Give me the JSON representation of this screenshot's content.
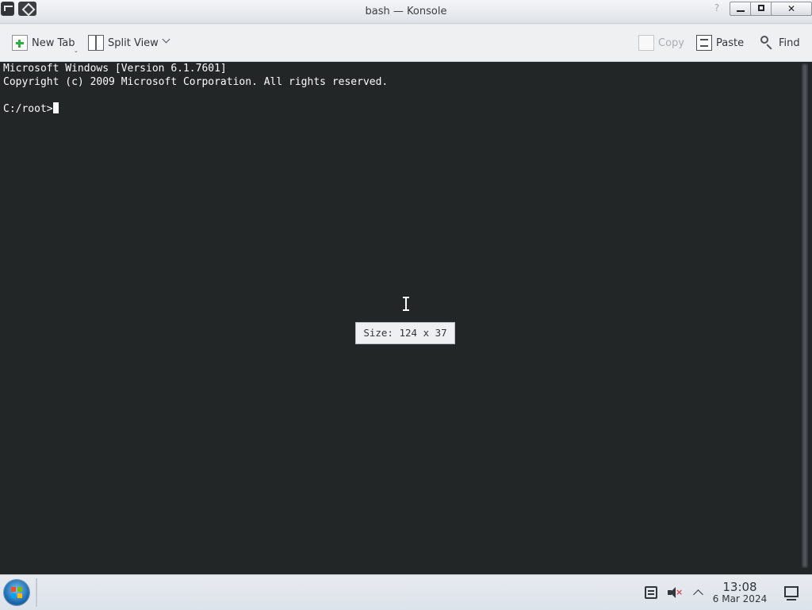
{
  "window": {
    "title": "bash — Konsole"
  },
  "toolbar": {
    "new_tab": "New Tab",
    "split_view": "Split View",
    "copy": "Copy",
    "paste": "Paste",
    "find": "Find"
  },
  "terminal": {
    "lines": [
      "Microsoft Windows [Version 6.1.7601]",
      "Copyright (c) 2009 Microsoft Corporation. All rights reserved.",
      "",
      "C:/root>"
    ],
    "size_popup": "Size: 124 x 37"
  },
  "taskbar": {
    "time": "13:08",
    "date": "6 Mar 2024"
  },
  "colors": {
    "terminal_bg": "#232627",
    "terminal_fg": "#fcfcfc",
    "toolbar_bg": "#eff0f1",
    "accent_green": "#2eae3c"
  },
  "icons": {
    "app": "konsole-icon",
    "menu": "window-menu-icon",
    "new_tab": "new-tab-icon",
    "split": "split-view-icon",
    "copy": "copy-icon",
    "paste": "paste-icon",
    "find": "find-icon"
  }
}
